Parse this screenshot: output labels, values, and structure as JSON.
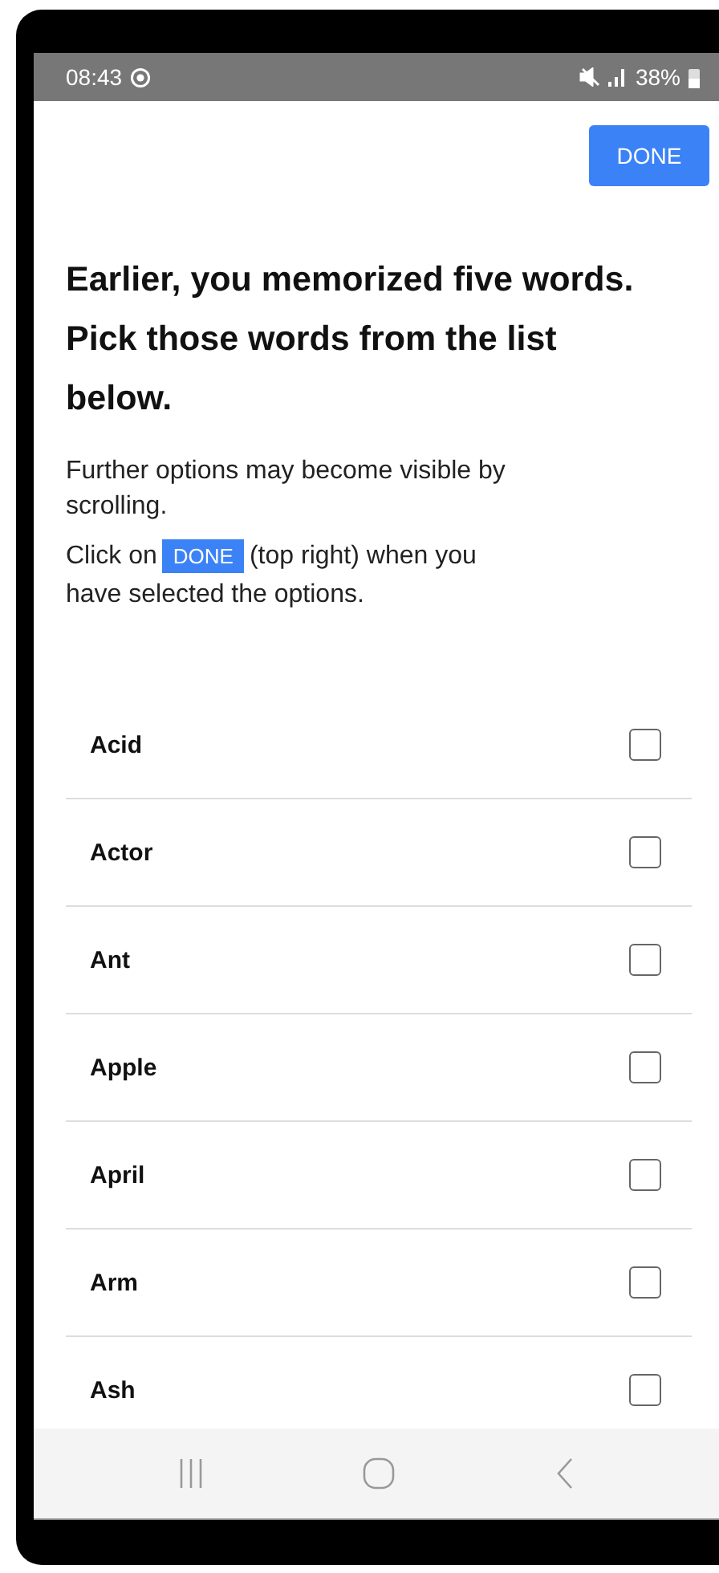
{
  "status_bar": {
    "time": "08:43",
    "battery": "38%"
  },
  "done_button": {
    "label": "DONE"
  },
  "heading": [
    "Earlier, you memorized five words.",
    "Pick those words from the list below."
  ],
  "hint": "Further options may become visible by scrolling.",
  "instruction": {
    "before": "Click on",
    "chip": "DONE",
    "after": "(top right) when you",
    "continued": "have selected the options."
  },
  "options": [
    {
      "label": "Acid",
      "checked": false
    },
    {
      "label": "Actor",
      "checked": false
    },
    {
      "label": "Ant",
      "checked": false
    },
    {
      "label": "Apple",
      "checked": false
    },
    {
      "label": "April",
      "checked": false
    },
    {
      "label": "Arm",
      "checked": false
    },
    {
      "label": "Ash",
      "checked": false
    }
  ]
}
